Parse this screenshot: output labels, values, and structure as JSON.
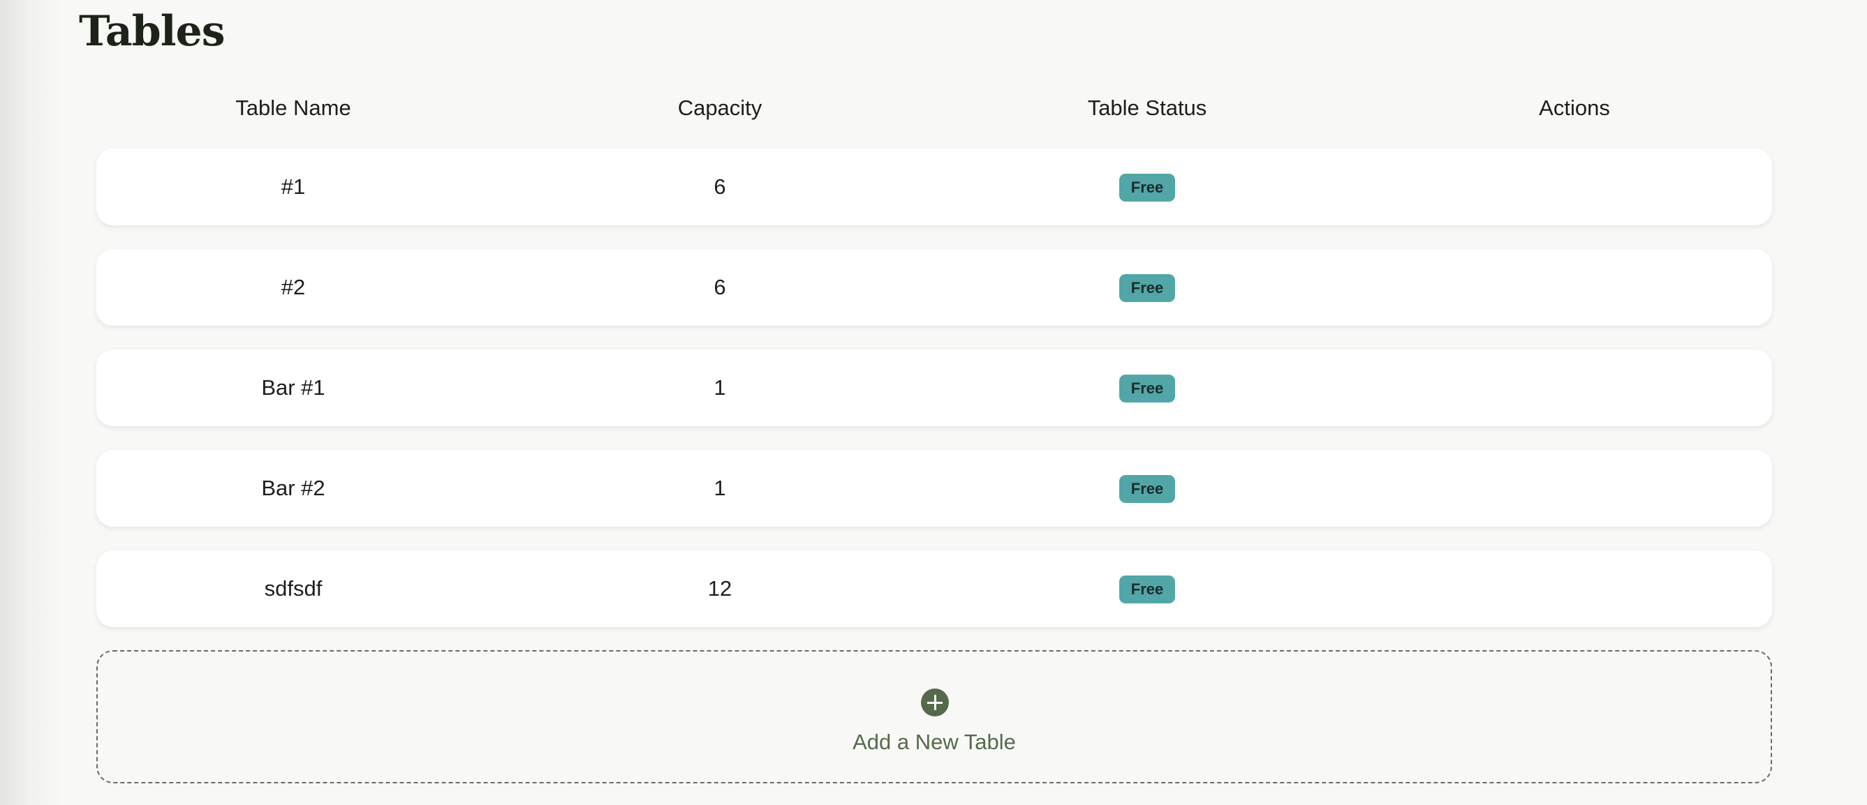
{
  "page": {
    "title": "Tables"
  },
  "table": {
    "columns": [
      "Table Name",
      "Capacity",
      "Table Status",
      "Actions"
    ],
    "rows": [
      {
        "name": "#1",
        "capacity": "6",
        "status": "Free"
      },
      {
        "name": "#2",
        "capacity": "6",
        "status": "Free"
      },
      {
        "name": "Bar #1",
        "capacity": "1",
        "status": "Free"
      },
      {
        "name": "Bar #2",
        "capacity": "1",
        "status": "Free"
      },
      {
        "name": "sdfsdf",
        "capacity": "12",
        "status": "Free"
      }
    ]
  },
  "add_table": {
    "label": "Add a New Table",
    "icon": "plus-circle-icon"
  },
  "colors": {
    "background": "#f8f8f6",
    "status_free": "#52a6a7",
    "accent": "#556a4a"
  }
}
